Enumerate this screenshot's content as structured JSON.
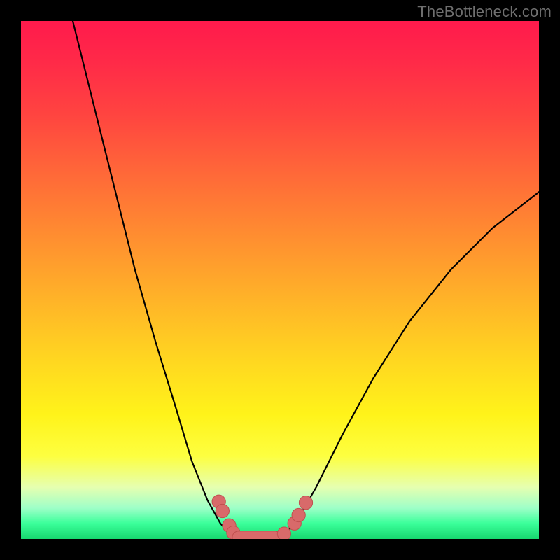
{
  "watermark": "TheBottleneck.com",
  "colors": {
    "frame": "#000000",
    "curve": "#000000",
    "bead_fill": "#d86a6a",
    "bead_stroke": "#c04f4f",
    "gradient_top": "#ff1a4c",
    "gradient_bottom": "#17d86f",
    "watermark_text": "#6f6f6f"
  },
  "chart_data": {
    "type": "line",
    "title": "",
    "xlabel": "",
    "ylabel": "",
    "xlim": [
      0,
      100
    ],
    "ylim": [
      0,
      100
    ],
    "grid": false,
    "legend": false,
    "series": [
      {
        "name": "left-branch",
        "x": [
          10,
          14,
          18,
          22,
          26,
          30,
          33,
          36,
          38.5,
          40.5,
          42
        ],
        "y": [
          100,
          84,
          68,
          52,
          38,
          25,
          15,
          7.5,
          3,
          0.7,
          0
        ]
      },
      {
        "name": "floor",
        "x": [
          42,
          44,
          46,
          48,
          50
        ],
        "y": [
          0,
          0,
          0,
          0,
          0
        ]
      },
      {
        "name": "right-branch",
        "x": [
          50,
          53,
          57,
          62,
          68,
          75,
          83,
          91,
          100
        ],
        "y": [
          0,
          3,
          10,
          20,
          31,
          42,
          52,
          60,
          67
        ]
      }
    ],
    "beads": [
      {
        "x": 38.2,
        "y": 7.2,
        "r": 1.3
      },
      {
        "x": 38.9,
        "y": 5.4,
        "r": 1.3
      },
      {
        "x": 40.2,
        "y": 2.6,
        "r": 1.3
      },
      {
        "x": 41.0,
        "y": 1.2,
        "r": 1.3
      },
      {
        "shape": "capsule",
        "x1": 42.0,
        "y1": 0.3,
        "x2": 49.0,
        "y2": 0.3,
        "r": 1.2
      },
      {
        "x": 50.8,
        "y": 1.0,
        "r": 1.3
      },
      {
        "x": 52.8,
        "y": 3.0,
        "r": 1.3
      },
      {
        "x": 53.6,
        "y": 4.6,
        "r": 1.3
      },
      {
        "x": 55.0,
        "y": 7.0,
        "r": 1.3
      }
    ]
  }
}
